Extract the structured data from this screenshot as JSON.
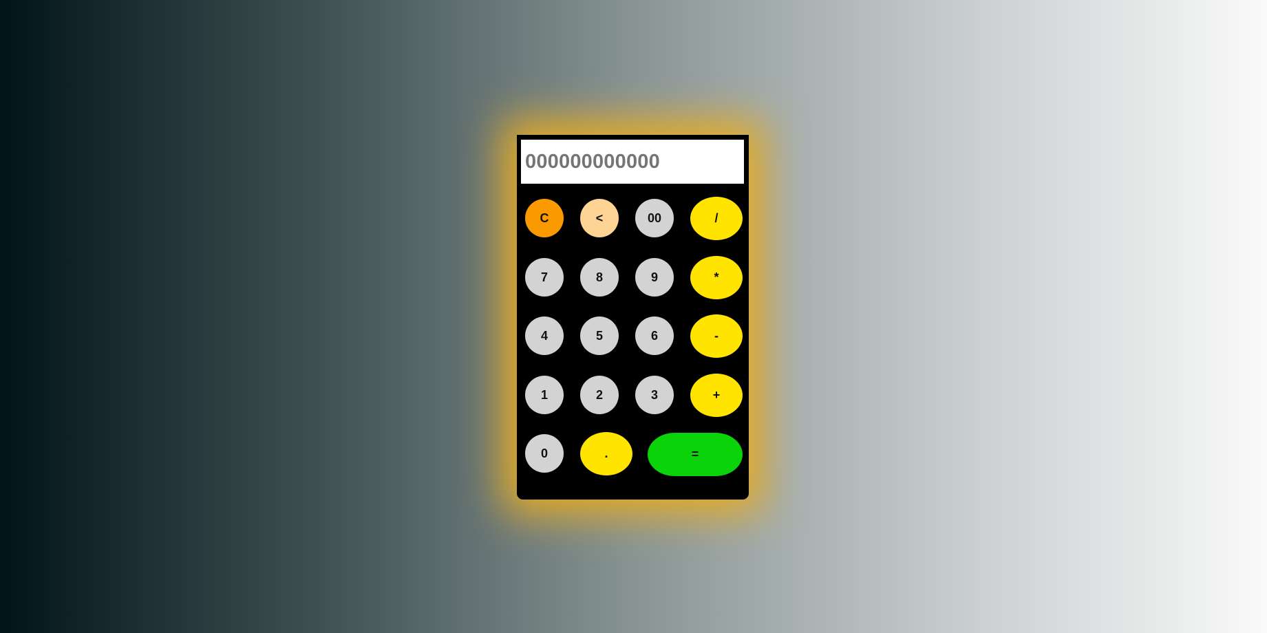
{
  "display": {
    "placeholder": "000000000000",
    "value": ""
  },
  "keys": {
    "clear": "C",
    "backspace": "<",
    "double_zero": "00",
    "divide": "/",
    "seven": "7",
    "eight": "8",
    "nine": "9",
    "multiply": "*",
    "four": "4",
    "five": "5",
    "six": "6",
    "subtract": "-",
    "one": "1",
    "two": "2",
    "three": "3",
    "add": "+",
    "zero": "0",
    "decimal": ".",
    "equals": "="
  },
  "colors": {
    "glow": "#e6ac24",
    "clear_key": "#fa9a00",
    "backspace_key": "#fed495",
    "digit_key": "#d3d3d3",
    "operator_key": "#ffe400",
    "equals_key": "#0ad30a"
  }
}
